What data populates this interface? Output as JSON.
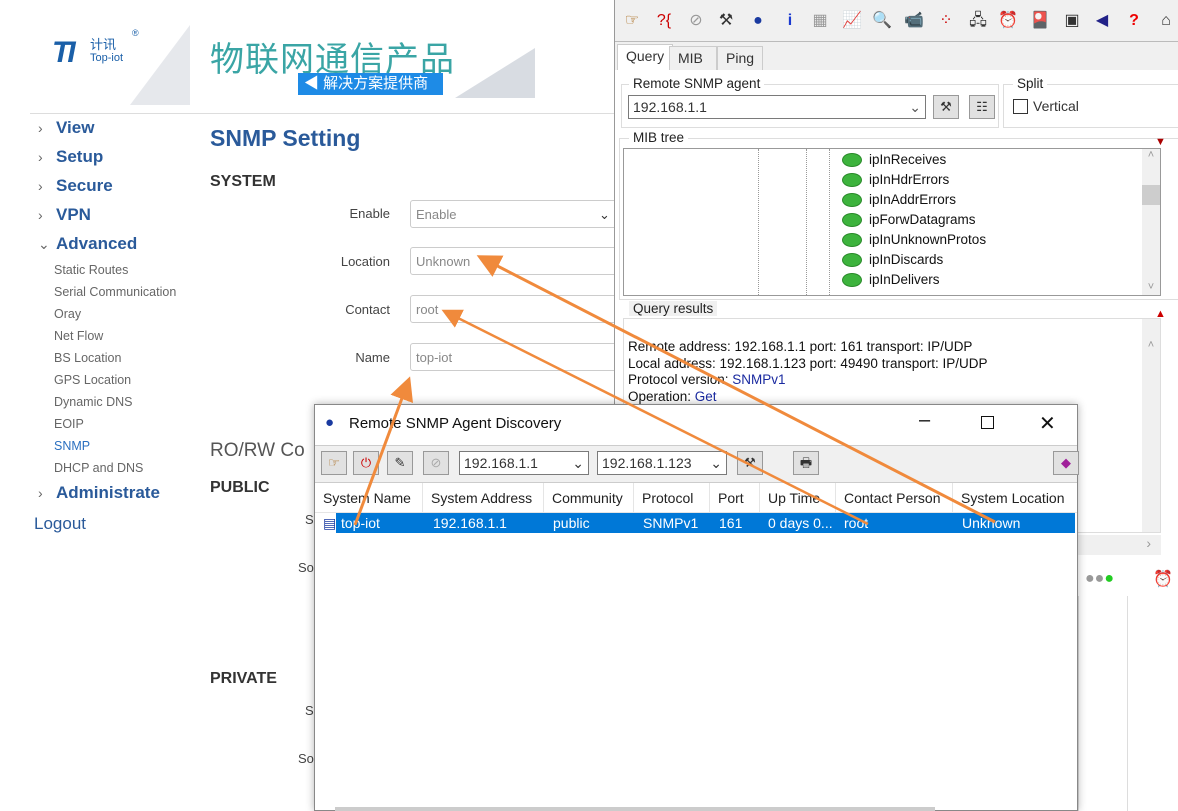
{
  "web": {
    "logo": {
      "mark": "TI",
      "cn": "计讯",
      "en": "Top-iot",
      "reg": "®"
    },
    "slogan": "物联网通信产品",
    "slogan_badge": "解决方案提供商",
    "nav": [
      {
        "label": "View",
        "expanded": false
      },
      {
        "label": "Setup",
        "expanded": false
      },
      {
        "label": "Secure",
        "expanded": false
      },
      {
        "label": "VPN",
        "expanded": false
      },
      {
        "label": "Advanced",
        "expanded": true
      },
      {
        "label": "Administrate",
        "expanded": false
      }
    ],
    "subnav": [
      "Static Routes",
      "Serial Communication",
      "Oray",
      "Net Flow",
      "BS Location",
      "GPS Location",
      "Dynamic DNS",
      "EOIP",
      "SNMP",
      "DHCP and DNS"
    ],
    "active_sub": "SNMP",
    "logout": "Logout",
    "page_title": "SNMP Setting",
    "system_heading": "SYSTEM",
    "fields": [
      {
        "label": "Enable",
        "value": "Enable",
        "type": "select"
      },
      {
        "label": "Location",
        "value": "Unknown"
      },
      {
        "label": "Contact",
        "value": "root"
      },
      {
        "label": "Name",
        "value": "top-iot"
      }
    ],
    "rorw_heading": "RO/RW Co",
    "public_heading": "PUBLIC",
    "private_heading": "PRIVATE",
    "fragments": [
      "S",
      "So",
      "S",
      "So"
    ]
  },
  "mib": {
    "tabs": [
      "Query",
      "MIB",
      "Ping"
    ],
    "active_tab": "Query",
    "agent_label": "Remote SNMP agent",
    "agent_value": "192.168.1.1",
    "split_label": "Split",
    "vertical_label": "Vertical",
    "vertical_checked": false,
    "tree_label": "MIB tree",
    "tree_items": [
      "ipInReceives",
      "ipInHdrErrors",
      "ipInAddrErrors",
      "ipForwDatagrams",
      "ipInUnknownProtos",
      "ipInDiscards",
      "ipInDelivers"
    ],
    "results_label": "Query results",
    "results": {
      "remote": "Remote address: 192.168.1.1  port: 161 transport: IP/UDP",
      "local": "Local address: 192.168.1.123  port: 49490 transport: IP/UDP",
      "protocol_label": "Protocol version: ",
      "protocol": "SNMPv1",
      "operation_label": "Operation: ",
      "operation": "Get"
    }
  },
  "discovery": {
    "title": "Remote SNMP Agent Discovery",
    "from_ip": "192.168.1.1",
    "to_ip": "192.168.1.123",
    "columns": [
      "System Name",
      "System Address",
      "Community",
      "Protocol",
      "Port",
      "Up Time",
      "Contact Person",
      "System Location"
    ],
    "rows": [
      [
        "top-iot",
        "192.168.1.1",
        "public",
        "SNMPv1",
        "161",
        "0 days 0...",
        "root",
        "Unknown"
      ]
    ]
  },
  "colors": {
    "accent": "#2a5a9a",
    "selection": "#0078d7",
    "arrow": "#f08a3c"
  }
}
